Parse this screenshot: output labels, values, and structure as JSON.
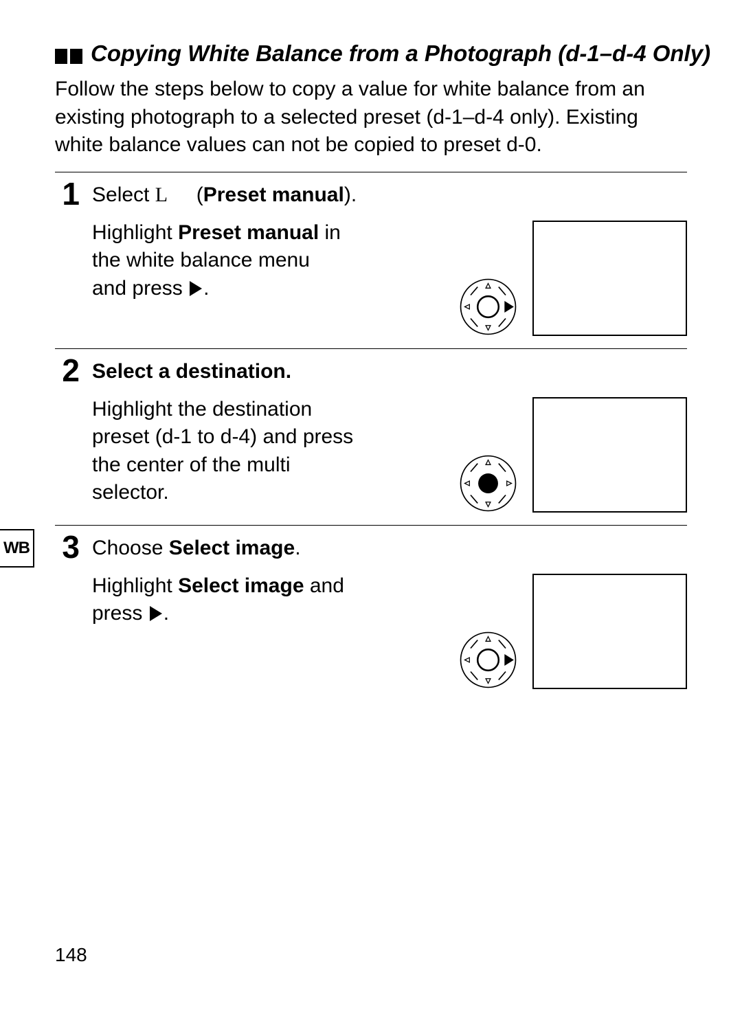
{
  "header": {
    "title": "Copying White Balance from a Photograph (d-1–d-4 Only)"
  },
  "intro": "Follow the steps below to copy a value for white balance from an existing photograph to a selected preset (d-1–d-4 only).  Existing white balance values can not be copied to preset d-0.",
  "steps": [
    {
      "num": "1",
      "title_before": "Select ",
      "title_symbol": "L",
      "title_gap": "     ",
      "title_bold_open": "(",
      "title_bold": "Preset manual",
      "title_bold_close": ").",
      "body_pre": "Highlight ",
      "body_bold": "Preset manual",
      "body_post1": " in the white balance menu",
      "body_post2": "and press ",
      "selector_variant": "right"
    },
    {
      "num": "2",
      "title_plain": "Select a destination.",
      "body_full": "Highlight the destination preset (d-1 to d-4) and press the center of the multi selector.",
      "selector_variant": "center"
    },
    {
      "num": "3",
      "title_before": "Choose ",
      "title_bold": "Select image",
      "title_after": ".",
      "body_pre": "Highlight ",
      "body_bold": "Select image",
      "body_post1": " and press ",
      "selector_variant": "right"
    }
  ],
  "sidebar_tab": "WB",
  "page_number": "148"
}
